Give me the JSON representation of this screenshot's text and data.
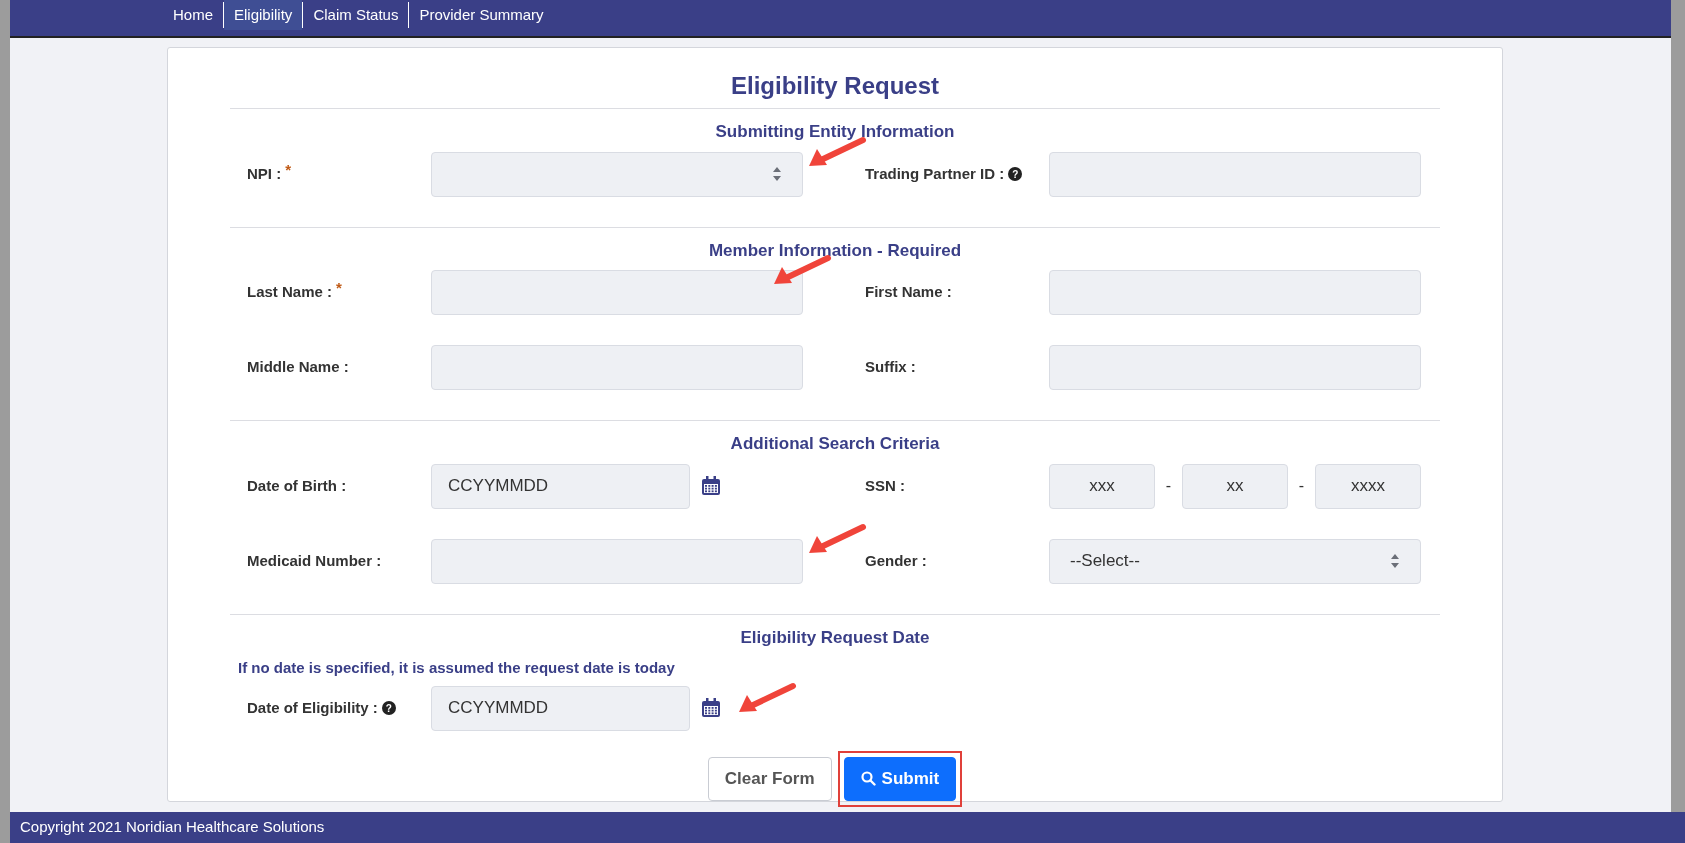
{
  "nav": [
    {
      "label": "Home",
      "selected": false
    },
    {
      "label": "Eligibility",
      "selected": true
    },
    {
      "label": "Claim Status",
      "selected": false
    },
    {
      "label": "Provider Summary",
      "selected": false
    }
  ],
  "title": "Eligibility Request",
  "sections": [
    {
      "heading": "Submitting Entity Information",
      "fields": [
        {
          "kind": "select",
          "label": "NPI :",
          "required_mark": "*",
          "callout": true
        },
        {
          "kind": "text",
          "label": "Trading Partner ID :",
          "help_mark": "?",
          "callout": false
        }
      ]
    },
    {
      "heading": "Member Information - Required",
      "fields": [
        {
          "kind": "text",
          "label": "Last Name :",
          "required_mark": "*",
          "callout": true
        },
        {
          "kind": "text",
          "label": "First Name :",
          "callout": false
        },
        {
          "kind": "text",
          "label": "Middle Name :",
          "callout": false
        },
        {
          "kind": "text",
          "label": "Suffix :",
          "callout": false
        }
      ]
    },
    {
      "heading": "Additional Search Criteria",
      "fields": [
        {
          "kind": "date",
          "label": "Date of Birth :",
          "placeholder": "CCYYMMDD",
          "callout": false
        },
        {
          "kind": "ssn",
          "label": "SSN :",
          "parts": [
            {
              "placeholder": "xxx"
            },
            {
              "placeholder": "xx"
            },
            {
              "placeholder": "xxxx"
            }
          ],
          "separators": [
            "-",
            "-"
          ],
          "callout": false
        },
        {
          "kind": "text",
          "label": "Medicaid Number :",
          "callout": true
        },
        {
          "kind": "select",
          "label": "Gender :",
          "value": "--Select--",
          "callout": false
        }
      ]
    },
    {
      "heading": "Eligibility Request Date",
      "note": "If no date is specified, it is assumed the request date is today",
      "fields": [
        {
          "kind": "date",
          "label": "Date of Eligibility :",
          "help_mark": "?",
          "placeholder": "CCYYMMDD",
          "callout": true
        }
      ]
    }
  ],
  "buttons": [
    {
      "label": "Clear Form",
      "kind": "secondary",
      "highlighted": false
    },
    {
      "label": "Submit",
      "kind": "primary",
      "highlighted": true
    }
  ],
  "footer": "Copyright 2021 Noridian Healthcare Solutions"
}
